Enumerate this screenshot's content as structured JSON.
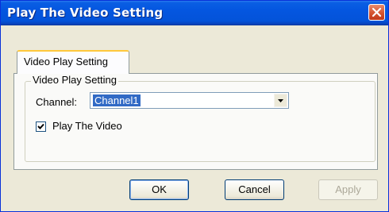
{
  "window": {
    "title": "Play The Video Setting",
    "close_icon": "close-icon"
  },
  "tab": {
    "label": "Video Play Setting"
  },
  "group": {
    "legend": "Video Play Setting"
  },
  "channel": {
    "label": "Channel:",
    "selected": "Channel1",
    "arrow_icon": "chevron-down-icon"
  },
  "play_video": {
    "label": "Play The Video",
    "checked": true
  },
  "buttons": {
    "ok": "OK",
    "cancel": "Cancel",
    "apply": "Apply",
    "apply_enabled": false
  },
  "colors": {
    "titlebar": "#0456e0",
    "window_bg": "#ece9d8",
    "selection": "#316ac5",
    "close": "#d4542f"
  }
}
